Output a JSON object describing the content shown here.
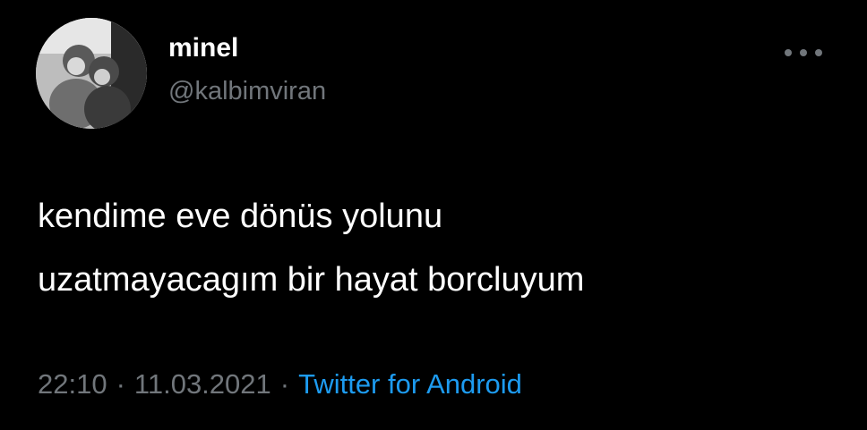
{
  "author": {
    "display_name": "minel",
    "handle": "@kalbimviran",
    "avatar_icon": "profile-photo"
  },
  "menu": {
    "icon": "more-dots-icon"
  },
  "tweet": {
    "text": "kendime eve dönüs yolunu\nuzatmayacagım bir hayat borcluyum",
    "time": "22:10",
    "date": "11.03.2021",
    "separator": "·",
    "source": "Twitter for Android"
  },
  "colors": {
    "background": "#000000",
    "text": "#ffffff",
    "secondary": "#71767b",
    "link": "#1d9bf0"
  }
}
